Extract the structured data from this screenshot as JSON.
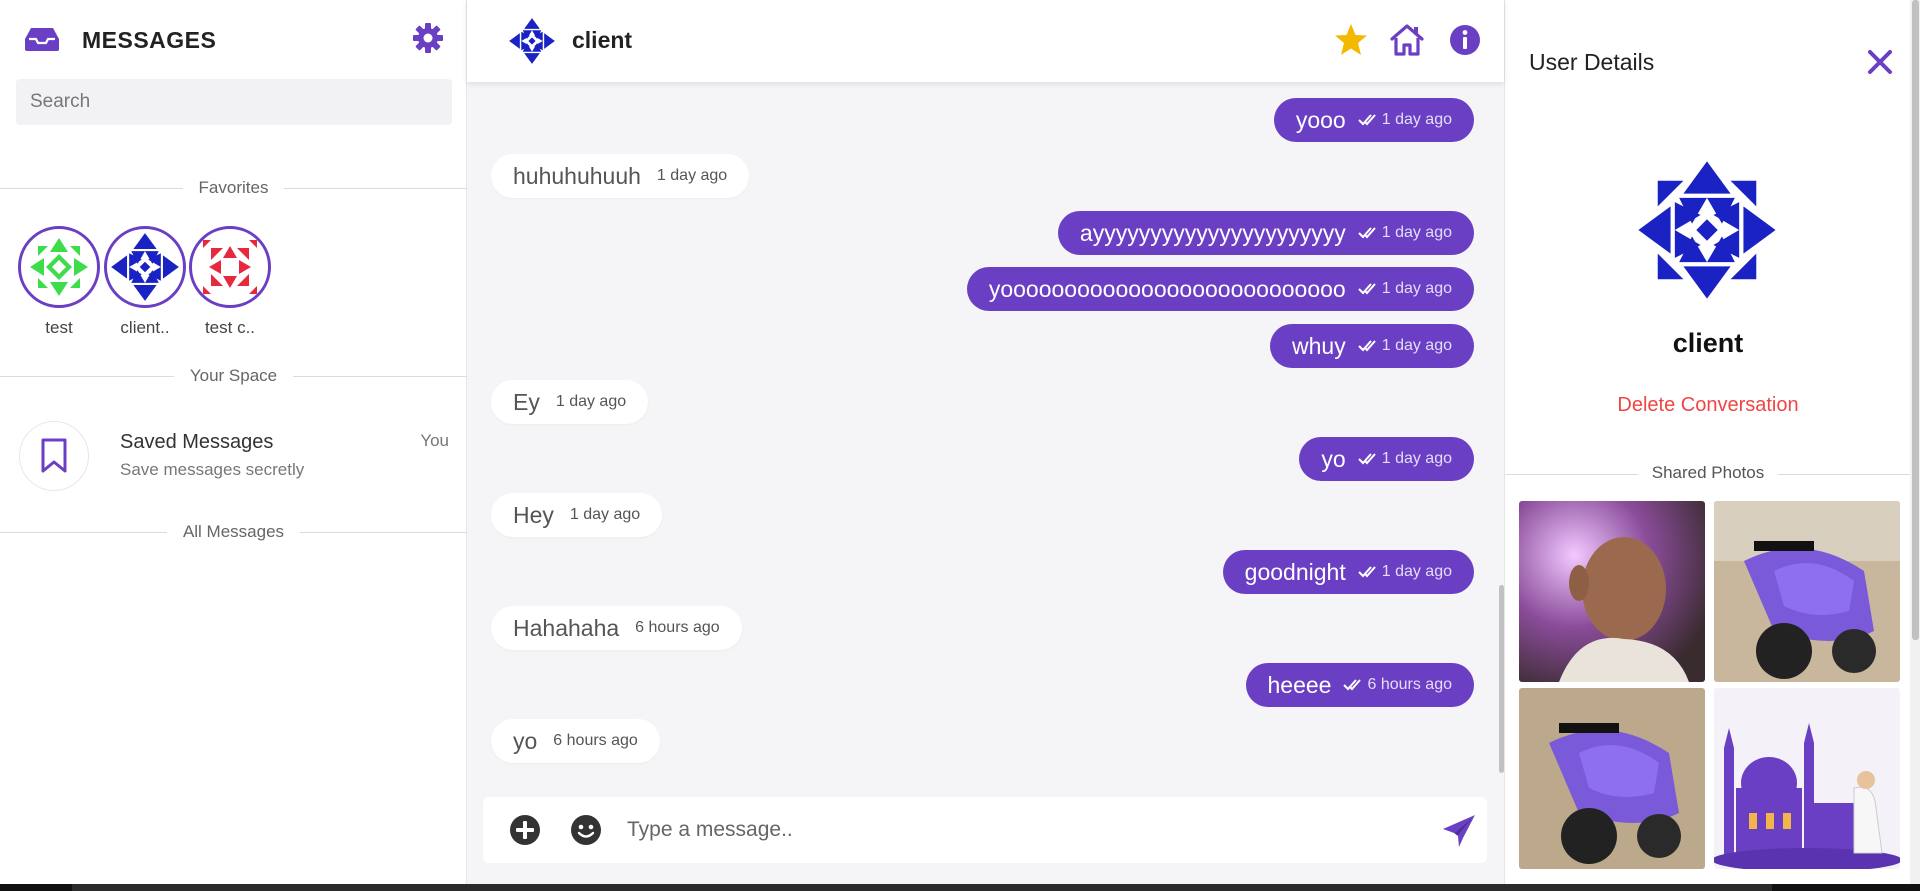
{
  "sidebar": {
    "title": "MESSAGES",
    "search_placeholder": "Search",
    "favorites_label": "Favorites",
    "favorites": [
      {
        "label": "test",
        "color": "#3ddc4a"
      },
      {
        "label": "client..",
        "color": "#1a22c4"
      },
      {
        "label": "test c..",
        "color": "#e8283f"
      }
    ],
    "your_space_label": "Your Space",
    "saved": {
      "name": "Saved Messages",
      "subtitle": "Save messages secretly",
      "tag": "You"
    },
    "all_messages_label": "All Messages"
  },
  "chat": {
    "contact_name": "client",
    "messages": [
      {
        "dir": "out",
        "text": "yooo",
        "time": "1 day ago"
      },
      {
        "dir": "in",
        "text": "huhuhuhuuh",
        "time": "1 day ago"
      },
      {
        "dir": "out",
        "text": "ayyyyyyyyyyyyyyyyyyyyyy",
        "time": "1 day ago"
      },
      {
        "dir": "out",
        "text": "yooooooooooooooooooooooooooo",
        "time": "1 day ago"
      },
      {
        "dir": "out",
        "text": "whuy",
        "time": "1 day ago"
      },
      {
        "dir": "in",
        "text": "Ey",
        "time": "1 day ago"
      },
      {
        "dir": "out",
        "text": "yo",
        "time": "1 day ago"
      },
      {
        "dir": "in",
        "text": "Hey",
        "time": "1 day ago"
      },
      {
        "dir": "out",
        "text": "goodnight",
        "time": "1 day ago"
      },
      {
        "dir": "in",
        "text": "Hahahaha",
        "time": "6 hours ago"
      },
      {
        "dir": "out",
        "text": "heeee",
        "time": "6 hours ago"
      },
      {
        "dir": "in",
        "text": "yo",
        "time": "6 hours ago"
      }
    ],
    "composer_placeholder": "Type a message.."
  },
  "details": {
    "title": "User Details",
    "name": "client",
    "delete_label": "Delete Conversation",
    "shared_photos_label": "Shared Photos"
  },
  "colors": {
    "accent": "#6a3fc4",
    "star": "#f5b800",
    "danger": "#f04545"
  }
}
